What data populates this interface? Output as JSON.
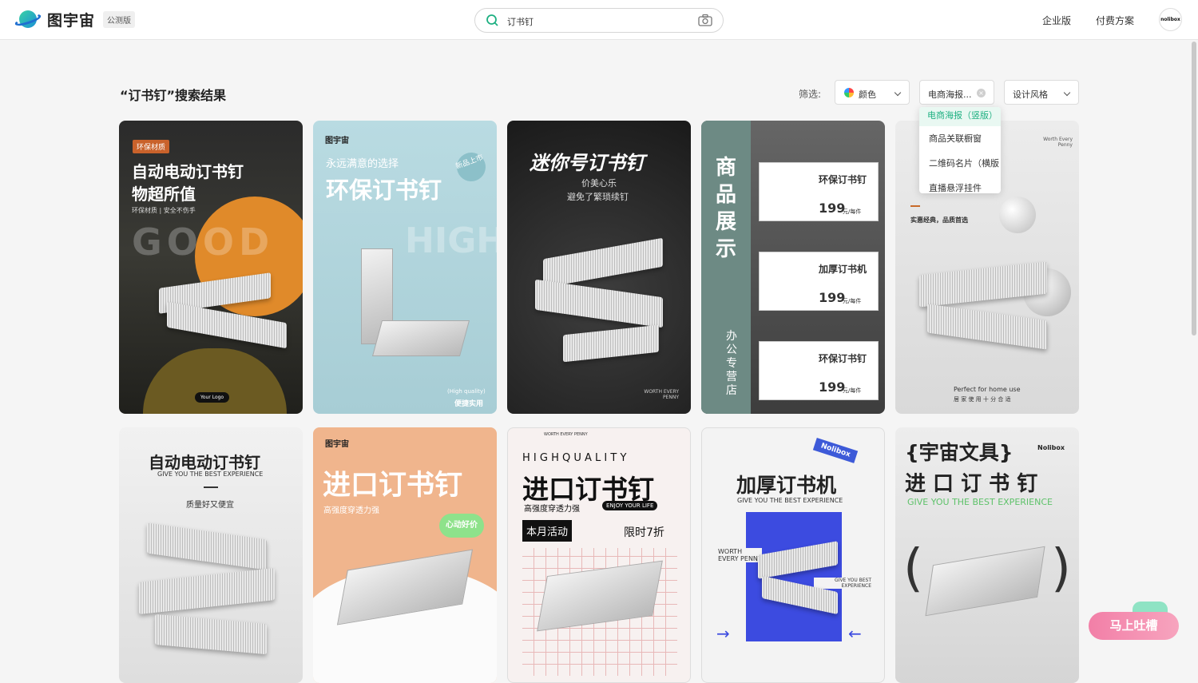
{
  "header": {
    "logo_text": "图宇宙",
    "beta_badge": "公测版",
    "search_query": "订书钉",
    "nav": [
      "企业版",
      "付费方案"
    ],
    "avatar_text": "nolibox"
  },
  "results": {
    "title": "“订书钉”搜索结果",
    "filter_label": "筛选:",
    "filters": {
      "color": "颜色",
      "category": "电商海报...",
      "style": "设计风格"
    },
    "dropdown_options": [
      "电商海报（竖版）",
      "商品关联橱窗",
      "二维码名片（横版",
      "直播悬浮挂件"
    ]
  },
  "cards": {
    "c1": {
      "badge": "环保材质",
      "title1": "自动电动订书钉",
      "title2": "物超所值",
      "sub": "环保材质 | 安全不伤手",
      "bg_text": "GOOD",
      "logo": "Your Logo"
    },
    "c2": {
      "brand": "图宇宙",
      "line1": "永远满意的选择",
      "title": "环保订书钉",
      "stamp": "新品上市",
      "bg_text": "HIGH",
      "foot1": "(High quality)",
      "foot2": "便捷实用"
    },
    "c3": {
      "title": "迷你号订书钉",
      "sub1": "价美心乐",
      "sub2": "避免了繁琐续钉",
      "foot": "WORTH EVERY PENNY"
    },
    "c4": {
      "vertical": "商品展示",
      "side": "办公专营店",
      "items": [
        {
          "name": "环保订书钉",
          "price": "199",
          "unit": "元/每件"
        },
        {
          "name": "加厚订书机",
          "price": "199",
          "unit": "元/每件"
        },
        {
          "name": "环保订书钉",
          "price": "199",
          "unit": "元/每件"
        }
      ]
    },
    "c5": {
      "top": "Worth Every Penny",
      "sub": "实惠经典，品质首选",
      "en": "Perfect for home use",
      "cn": "居 家 使 用 十 分 合 适"
    },
    "c6": {
      "title": "自动电动订书钉",
      "en": "GIVE YOU THE BEST EXPERIENCE",
      "sub": "质量好又便宜"
    },
    "c7": {
      "brand": "图宇宙",
      "title": "进口订书钉",
      "sub": "高强度穿透力强",
      "badge": "心动好价"
    },
    "c8": {
      "border_text": "WORTH EVERY PENNY",
      "hq": "H I G H   Q U A L I T Y",
      "title": "进口订书钉",
      "sub": "高强度穿透力强",
      "enjoy": "ENJOY YOUR LIFE",
      "event": "本月活动",
      "discount": "限时7折"
    },
    "c9": {
      "tag": "Nolibox",
      "title": "加厚订书机",
      "en": "GIVE YOU THE BEST EXPERIENCE",
      "worth": "WORTH EVERY PENNY",
      "give": "GIVE YOU BEST EXPERIENCE"
    },
    "c10": {
      "title": "{宇宙文具}",
      "brand": "Nolibox",
      "title2": "进 口 订 书 钉",
      "en": "GIVE YOU THE BEST EXPERIENCE"
    }
  },
  "feedback": "马上吐槽"
}
